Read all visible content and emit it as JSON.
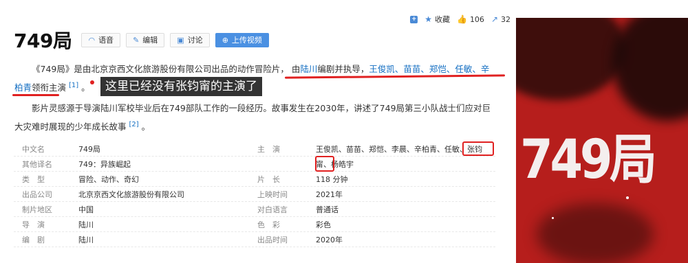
{
  "stats": {
    "favorite_label": "收藏",
    "like_count": "106",
    "share_count": "32"
  },
  "title": "749局",
  "toolbar": {
    "voice": "语音",
    "edit": "编辑",
    "discuss": "讨论",
    "upload": "上传视频"
  },
  "intro": {
    "p1_a": "《749局》是由北京京西文化旅游股份有限公司出品的动作冒险片， 由",
    "director_link": "陆川",
    "p1_b": "编剧并执导，",
    "cast_link": "王俊凯、苗苗、郑恺、任敏、辛柏青",
    "p1_c": "领衔主演",
    "ref1": "[1]",
    "p1_end": "。",
    "p2": "影片灵感源于导演陆川军校毕业后在749部队工作的一段经历。故事发生在2030年，讲述了749局第三小队战士们应对巨大灾难时展现的少年成长故事",
    "ref2": "[2]",
    "p2_end": "。"
  },
  "annotation": "这里已经没有张钧甯的主演了",
  "infobox": {
    "rows": [
      {
        "l1": "中文名",
        "v1": "749局",
        "l2": "主　演",
        "v2": "王俊凯、苗苗、郑恺、李晨、辛柏青、任敏、张钧"
      },
      {
        "l1": "其他译名",
        "v1": "749：异族崛起",
        "l2": "",
        "v2": "甯、杨皓宇"
      },
      {
        "l1": "类　型",
        "v1": "冒险、动作、奇幻",
        "l2": "片　长",
        "v2": "118 分钟"
      },
      {
        "l1": "出品公司",
        "v1": "北京京西文化旅游股份有限公司",
        "l2": "上映时间",
        "v2": "2021年"
      },
      {
        "l1": "制片地区",
        "v1": "中国",
        "l2": "对白语言",
        "v2": "普通话"
      },
      {
        "l1": "导　演",
        "v1": "陆川",
        "l2": "色　彩",
        "v2": "彩色"
      },
      {
        "l1": "编　剧",
        "v1": "陆川",
        "l2": "出品时间",
        "v2": "2020年"
      }
    ]
  },
  "poster": {
    "title": "749局"
  }
}
